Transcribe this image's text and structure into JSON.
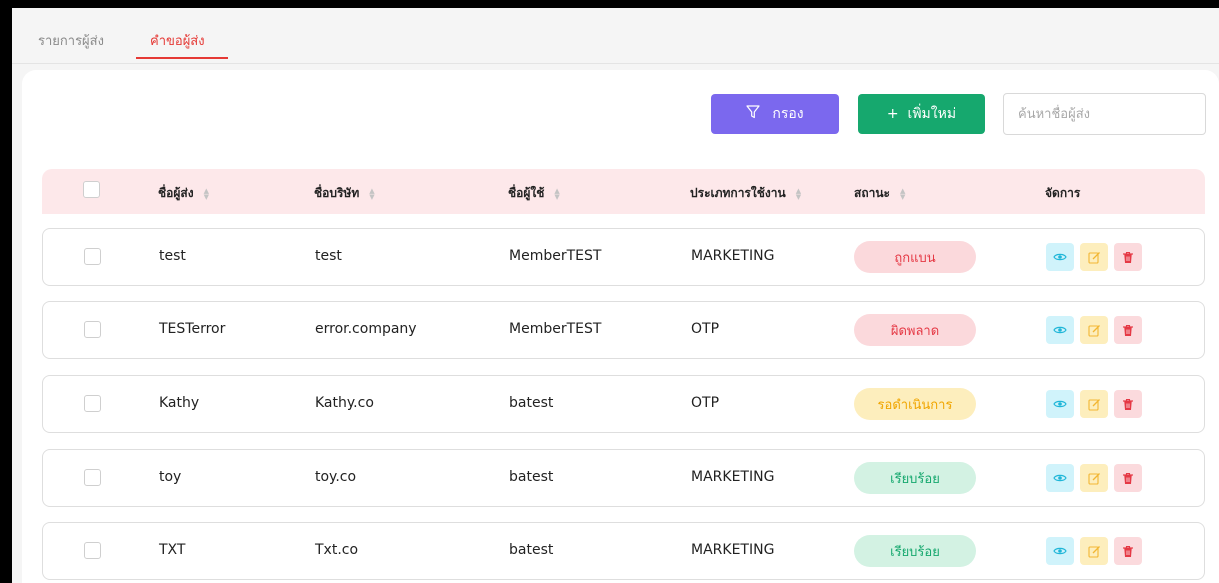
{
  "tabs": [
    {
      "label": "รายการผู้ส่ง",
      "active": false
    },
    {
      "label": "คำขอผู้ส่ง",
      "active": true
    }
  ],
  "toolbar": {
    "filter_label": "กรอง",
    "add_label": "+  เพิ่มใหม่",
    "search_placeholder": "ค้นหาชื่อผู้ส่ง"
  },
  "table": {
    "headers": {
      "sender": "ชื่อผู้ส่ง",
      "company": "ชื่อบริษัท",
      "user": "ชื่อผู้ใช้",
      "usage_type": "ประเภทการใช้งาน",
      "status": "สถานะ",
      "manage": "จัดการ"
    },
    "rows": [
      {
        "sender": "test",
        "company": "test",
        "user": "MemberTEST",
        "usage_type": "MARKETING",
        "status": "ถูกแบน",
        "status_kind": "banned"
      },
      {
        "sender": "TESTerror",
        "company": "error.company",
        "user": "MemberTEST",
        "usage_type": "OTP",
        "status": "ผิดพลาด",
        "status_kind": "error"
      },
      {
        "sender": "Kathy",
        "company": "Kathy.co",
        "user": "batest",
        "usage_type": "OTP",
        "status": "รอดำเนินการ",
        "status_kind": "pending"
      },
      {
        "sender": "toy",
        "company": "toy.co",
        "user": "batest",
        "usage_type": "MARKETING",
        "status": "เรียบร้อย",
        "status_kind": "done"
      },
      {
        "sender": "TXT",
        "company": "Txt.co",
        "user": "batest",
        "usage_type": "MARKETING",
        "status": "เรียบร้อย",
        "status_kind": "done"
      }
    ]
  },
  "colors": {
    "accent_red": "#e53935",
    "filter_button": "#7b68ee",
    "add_button": "#16a86e",
    "header_bg": "#fde8ea",
    "status_banned": {
      "bg": "#fbd9dc",
      "fg": "#e53945"
    },
    "status_error": {
      "bg": "#fbd9dc",
      "fg": "#e53945"
    },
    "status_pending": {
      "bg": "#fdeebd",
      "fg": "#f0a500"
    },
    "status_done": {
      "bg": "#d3f2e3",
      "fg": "#16a86e"
    }
  },
  "icons": {
    "filter": "funnel-icon",
    "view": "eye-icon",
    "edit": "edit-icon",
    "delete": "trash-icon",
    "sort": "sort-icon"
  }
}
